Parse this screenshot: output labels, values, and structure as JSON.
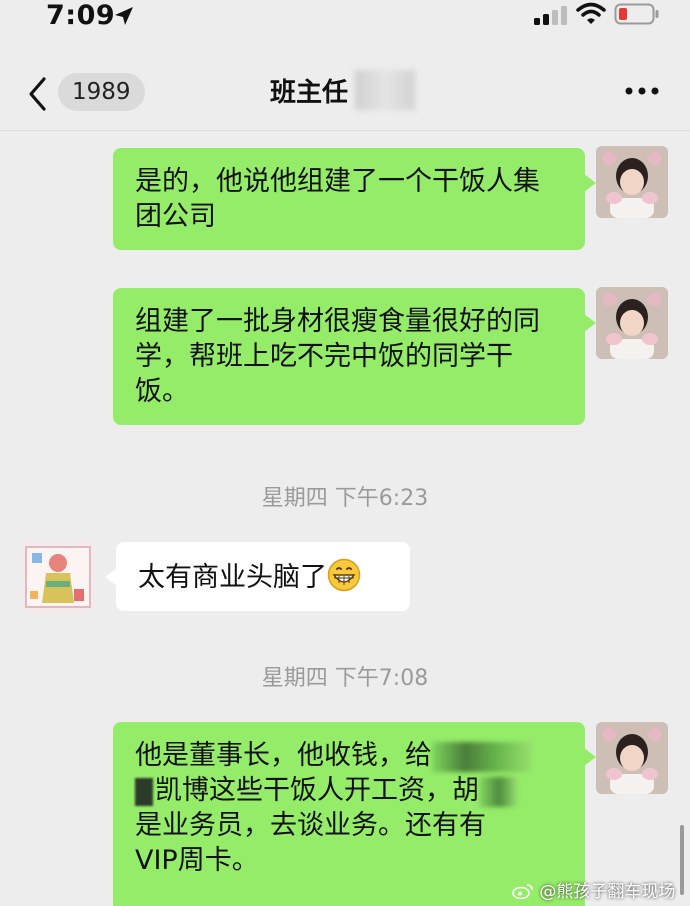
{
  "status_bar": {
    "time": "7:09",
    "icons": [
      "location-arrow-icon",
      "signal-icon",
      "wifi-icon",
      "battery-low-icon"
    ],
    "battery_color": "#e53935"
  },
  "nav": {
    "back_badge": "1989",
    "title": "班主任"
  },
  "colors": {
    "background": "#ededed",
    "bubble_sent": "#95ec69",
    "bubble_received": "#ffffff"
  },
  "messages": [
    {
      "side": "right",
      "text": "是的，他说他组建了一个干饭人集团公司"
    },
    {
      "side": "right",
      "text": "组建了一批身材很瘦食量很好的同学，帮班上吃不完中饭的同学干饭。"
    },
    {
      "type": "time",
      "text": "星期四 下午6:23"
    },
    {
      "side": "left",
      "text": "太有商业头脑了",
      "emoji": "grinning-face-icon"
    },
    {
      "type": "time",
      "text": "星期四 下午7:08"
    },
    {
      "side": "right",
      "text_parts": [
        "他是董事长，他收钱，给",
        "凯博这些干饭人开工资，胡",
        "是业务员，去谈业务。还有有",
        "VIP周卡。"
      ]
    }
  ],
  "watermark": {
    "text": "@熊孩子翻车现场"
  }
}
